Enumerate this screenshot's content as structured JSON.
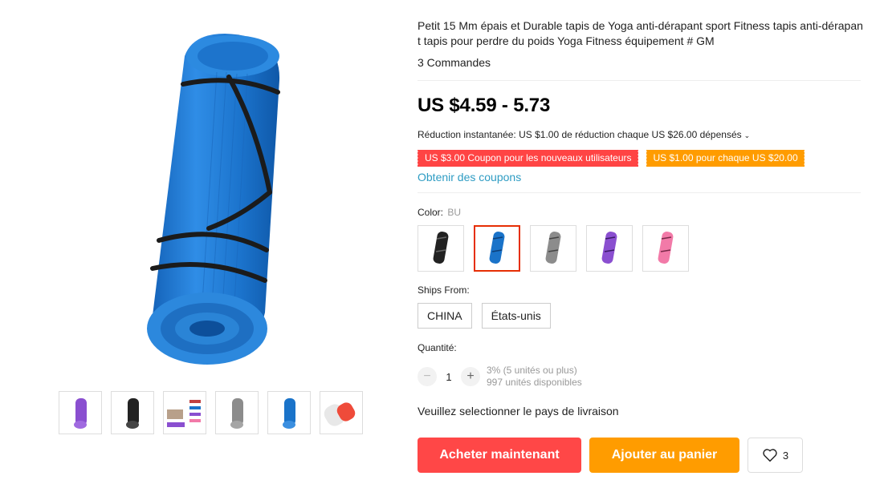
{
  "product": {
    "title": "Petit 15 Mm épais et Durable tapis de Yoga anti-dérapant sport Fitness tapis anti-dérapant tapis pour perdre du poids Yoga Fitness équipement # GM",
    "orders": "3 Commandes",
    "price": "US $4.59 - 5.73",
    "reduction": "Réduction instantanée: US $1.00 de réduction chaque US $26.00 dépensés",
    "coupons": [
      {
        "label": "US $3.00 Coupon pour les nouveaux utilisateurs",
        "color": "#ff4747"
      },
      {
        "label": "US $1.00 pour chaque US $20.00",
        "color": "#ff9c00"
      }
    ],
    "get_coupons": "Obtenir des coupons"
  },
  "color": {
    "label": "Color:",
    "selected": "BU",
    "swatches": [
      {
        "name": "black",
        "hex": "#222222"
      },
      {
        "name": "blue",
        "hex": "#1a73c9"
      },
      {
        "name": "gray",
        "hex": "#8c8c8c"
      },
      {
        "name": "purple",
        "hex": "#8a4fd0"
      },
      {
        "name": "pink",
        "hex": "#f27aa8"
      }
    ],
    "selected_index": 1
  },
  "ships": {
    "label": "Ships From:",
    "options": [
      "CHINA",
      "États-unis"
    ]
  },
  "quantity": {
    "label": "Quantité:",
    "value": "1",
    "minus": "−",
    "plus": "+",
    "discount": "3% (5 unités ou plus)",
    "available": "997 unités disponibles"
  },
  "shipping_message": "Veuillez selectionner le pays de livraison",
  "actions": {
    "buy": "Acheter maintenant",
    "cart": "Ajouter au panier",
    "wishlist_count": "3"
  },
  "gallery": {
    "thumbnails": [
      "purple-mat",
      "black-mat",
      "multi-color-mats",
      "gray-mat",
      "blue-mat",
      "white-red-mat"
    ]
  }
}
